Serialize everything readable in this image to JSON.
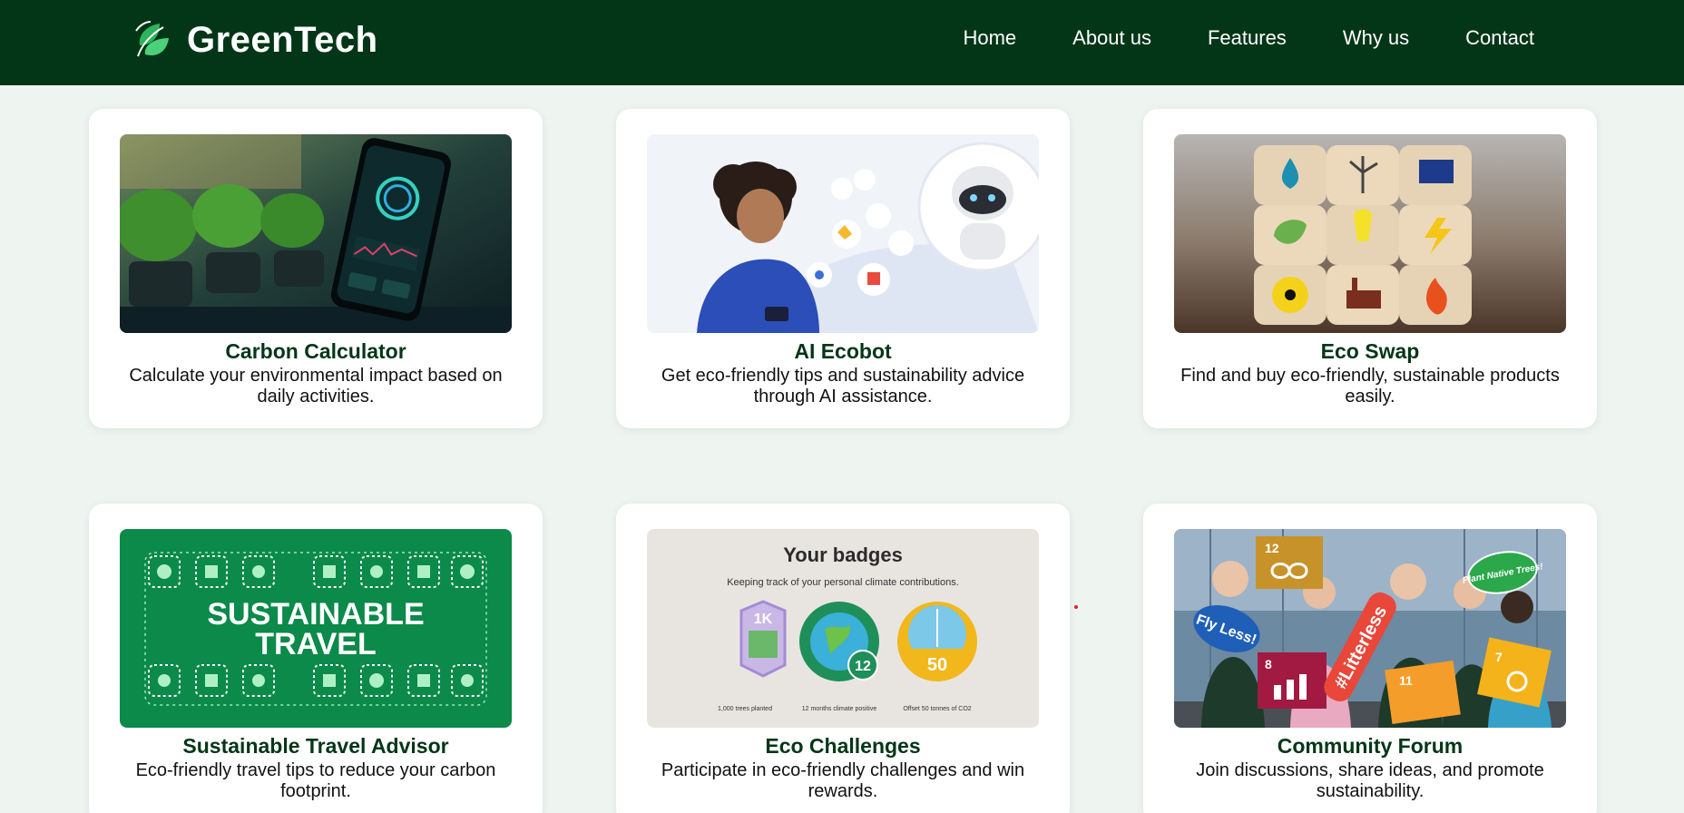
{
  "brand": {
    "name": "GreenTech",
    "logo_icon": "leaf-icon"
  },
  "nav": {
    "items": [
      "Home",
      "About us",
      "Features",
      "Why us",
      "Contact"
    ]
  },
  "colors": {
    "nav_bg": "#033617",
    "page_bg": "#eef5f1",
    "title_green": "#033617",
    "card_bg": "#ffffff"
  },
  "features": [
    {
      "title": "Carbon Calculator",
      "description": "Calculate your environmental impact based on daily activities.",
      "image": "phone-with-plants-image"
    },
    {
      "title": "AI Ecobot",
      "description": "Get eco-friendly tips and sustainability advice through AI assistance.",
      "image": "woman-and-robot-image"
    },
    {
      "title": "Eco Swap",
      "description": "Find and buy eco-friendly, sustainable products easily.",
      "image": "energy-cubes-image"
    },
    {
      "title": "Sustainable Travel Advisor",
      "description": "Eco-friendly travel tips to reduce your carbon footprint.",
      "image": "sustainable-travel-image",
      "image_text": {
        "line1": "SUSTAINABLE",
        "line2": "TRAVEL"
      }
    },
    {
      "title": "Eco Challenges",
      "description": "Participate in eco-friendly challenges and win rewards.",
      "image": "badges-image",
      "image_text": {
        "heading": "Your badges",
        "subheading": "Keeping track of your personal climate contributions.",
        "badges": [
          {
            "value": "1K",
            "caption": "1,000 trees planted"
          },
          {
            "value": "12",
            "caption": "12 months climate positive"
          },
          {
            "value": "50",
            "caption": "Offset 50 tonnes of CO2"
          }
        ]
      }
    },
    {
      "title": "Community Forum",
      "description": "Join discussions, share ideas, and promote sustainability.",
      "image": "community-protest-image",
      "image_text": {
        "sign1": "Fly Less!",
        "sign2": "#Litterless",
        "sign3": "Plant Native Trees!",
        "sdg12": "12",
        "sdg8": "8",
        "sdg11": "11",
        "sdg7": "7"
      }
    }
  ]
}
